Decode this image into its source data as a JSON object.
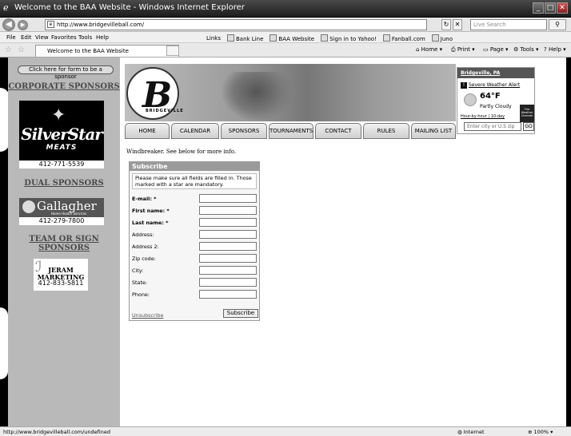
{
  "window": {
    "title": "Welcome to the BAA Website - Windows Internet Explorer",
    "min": "_",
    "max": "□",
    "close": "✕"
  },
  "address": {
    "back": "◀",
    "forward": "▶",
    "url": "http://www.bridgevilleball.com/",
    "refresh": "↻",
    "stop": "✕",
    "search_placeholder": "Live Search",
    "search_btn": "⚲"
  },
  "menu": {
    "items": [
      "File",
      "Edit",
      "View",
      "Favorites",
      "Tools",
      "Help"
    ],
    "links_label": "Links",
    "links": [
      "Bank Line",
      "BAA Website",
      "Sign in to Yahoo!",
      "Fanball.com",
      "Juno"
    ]
  },
  "tabbar": {
    "tab_title": "Welcome to the BAA Website",
    "home": "Home",
    "print": "Print",
    "page": "Page",
    "tools": "Tools",
    "help": "Help"
  },
  "sidebar": {
    "sponsor_form_btn": "Click here for form to be a sponsor",
    "corporate_heading": "CORPORATE SPONSORS",
    "silverstar_name": "SilverStar",
    "silverstar_sub": "MEATS",
    "silverstar_phone": "412-771-5539",
    "dual_heading": "DUAL SPONSORS",
    "gallagher_name": "Gallagher",
    "gallagher_sub": "Home Health Services",
    "gallagher_phone": "412-279-7800",
    "team_heading_1": "TEAM OR SIGN",
    "team_heading_2": "SPONSORS",
    "jeram_1": "JERAM",
    "jeram_2": "MARKETING",
    "jeram_phone": "412-833-5811"
  },
  "banner": {
    "logo_letter": "B",
    "logo_word": "BRIDGEVILLE"
  },
  "nav": [
    "HOME",
    "CALENDAR",
    "SPONSORS",
    "TOURNAMENTS",
    "CONTACT",
    "RULES",
    "MAILING LIST"
  ],
  "weather": {
    "location": "Bridgeville, PA",
    "alert": "Severe Weather Alert",
    "temp": "64°F",
    "condition": "Partly Cloudy",
    "hourly": "Hour-by-hour | 10-day",
    "brand": "The Weather Channel",
    "zip_placeholder": "Enter city or U.S zip",
    "go": "GO"
  },
  "content": {
    "windbreaker_text": "Windbreaker.  See below for more info."
  },
  "subscribe": {
    "heading": "Subscribe",
    "note": "Please make sure all fields are filled in. Those marked with a star are mandatory.",
    "fields": [
      {
        "label": "E-mail: *",
        "required": true
      },
      {
        "label": "First name: *",
        "required": true
      },
      {
        "label": "Last name: *",
        "required": true
      },
      {
        "label": "Address:",
        "required": false
      },
      {
        "label": "Address 2:",
        "required": false
      },
      {
        "label": "Zip code:",
        "required": false
      },
      {
        "label": "City:",
        "required": false
      },
      {
        "label": "State:",
        "required": false
      },
      {
        "label": "Phone:",
        "required": false
      }
    ],
    "unsubscribe": "Unsubscribe",
    "button": "Subscribe"
  },
  "status": {
    "url": "http://www.bridgevilleball.com/undefined",
    "zone": "Internet",
    "zoom": "100%"
  }
}
